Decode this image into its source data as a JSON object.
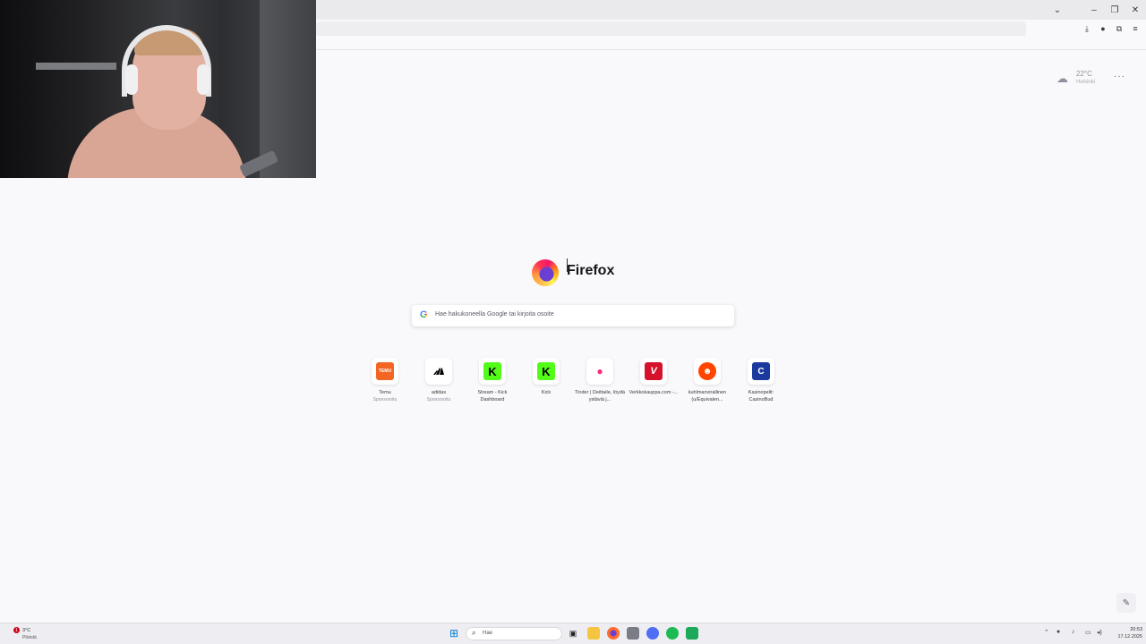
{
  "weather": {
    "temperature": "22°C",
    "city": "Helsinki",
    "icon": "cloud-sun-icon"
  },
  "logo": {
    "wordmark": "Firefox"
  },
  "search": {
    "placeholder": "Hae hakukoneella Google tai kirjoita osoite"
  },
  "top_sites": [
    {
      "title": "Temu",
      "subtitle": "Sponsoroitu",
      "favicon_text": "TEMU",
      "color": "#f26522"
    },
    {
      "title": "adidas",
      "subtitle": "Sponsoroitu",
      "favicon_text": "",
      "color": "#000000"
    },
    {
      "title": "Stream - Kick Dashboard",
      "subtitle": "",
      "favicon_text": "K",
      "color": "#53fc18"
    },
    {
      "title": "Kick",
      "subtitle": "",
      "favicon_text": "K",
      "color": "#53fc18"
    },
    {
      "title": "Tinder | Deittaile, löydä ystäviä j...",
      "subtitle": "",
      "favicon_text": "",
      "color": "#fd297b"
    },
    {
      "title": "Verkkokauppa.com -...",
      "subtitle": "",
      "favicon_text": "V",
      "color": "#d6112b"
    },
    {
      "title": "kuhlmanvirallinen (u/Equivalen...",
      "subtitle": "",
      "favicon_text": "",
      "color": "#ff4500"
    },
    {
      "title": "Kasinopelit: CasinoBud",
      "subtitle": "",
      "favicon_text": "C",
      "color": "#1a3a9e"
    }
  ],
  "taskbar": {
    "weather_temp": "3°C",
    "weather_condition": "Pilvistä",
    "weather_alert_count": "1",
    "search_label": "Hae",
    "time": "20:53",
    "date": "17.12.2025"
  }
}
